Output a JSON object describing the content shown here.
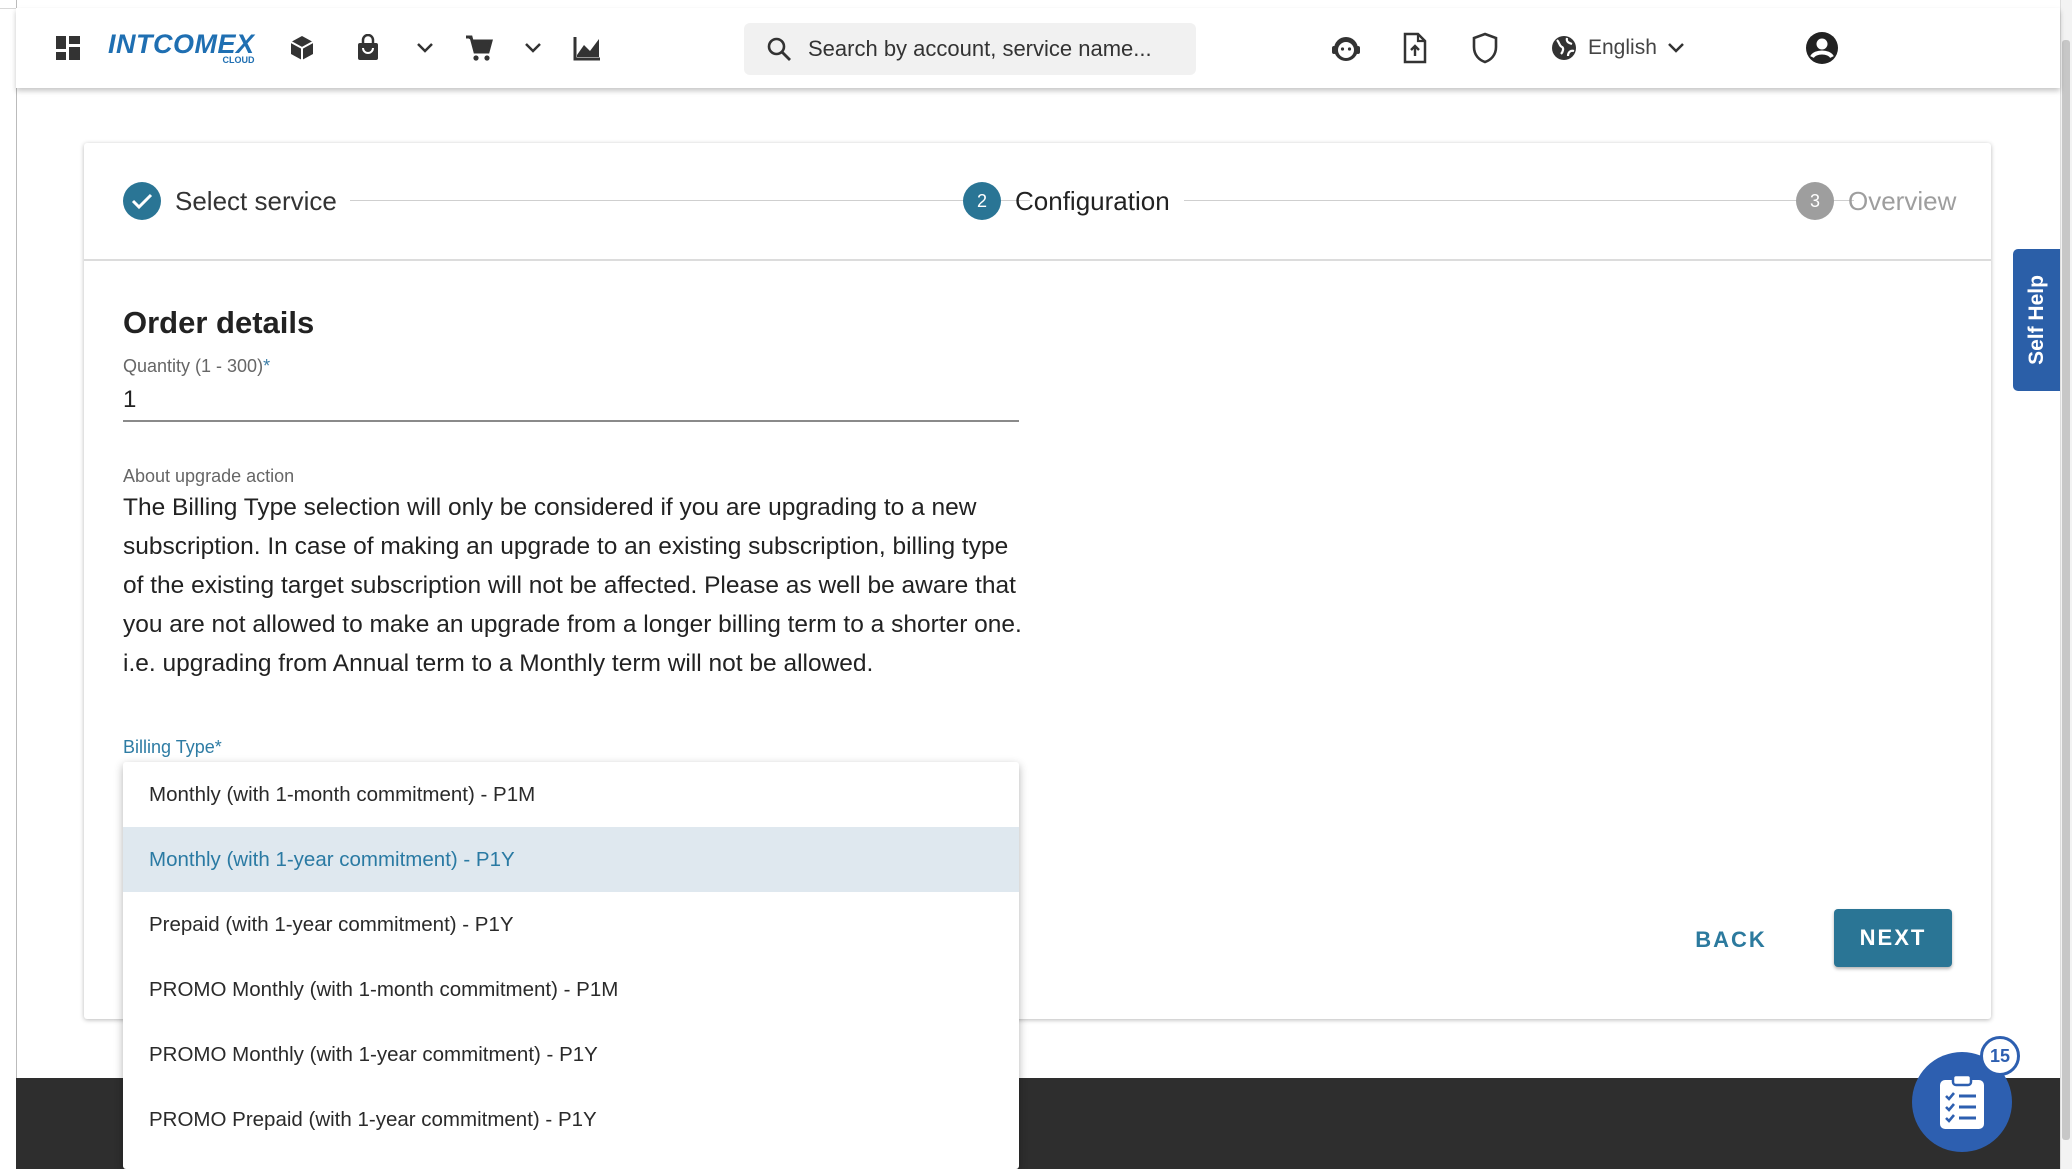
{
  "header": {
    "logo_text": "INTCOMEX",
    "logo_sub": "CLOUD",
    "search_placeholder": "Search by account, service name...",
    "language": "English",
    "icons": [
      "apps-grid-icon",
      "box-icon",
      "bag-icon",
      "chevron-down-icon",
      "cart-icon",
      "chevron-down-icon",
      "chart-icon",
      "search-icon",
      "support-agent-icon",
      "file-upload-icon",
      "shield-icon",
      "globe-icon",
      "account-circle-icon"
    ]
  },
  "stepper": {
    "steps": [
      {
        "number": "1",
        "label": "Select service",
        "state": "completed"
      },
      {
        "number": "2",
        "label": "Configuration",
        "state": "active"
      },
      {
        "number": "3",
        "label": "Overview",
        "state": "pending"
      }
    ]
  },
  "form": {
    "section_title": "Order details",
    "quantity_label": "Quantity (1 - 300)",
    "required_mark": "*",
    "quantity_value": "1",
    "about_label": "About upgrade action",
    "about_text": "The Billing Type selection will only be considered if you are upgrading to a new subscription. In case of making an upgrade to an existing subscription, billing type of the existing target subscription will not be affected. Please as well be aware that you are not allowed to make an upgrade from a longer billing term to a shorter one. i.e. upgrading from Annual term to a Monthly term will not be allowed.",
    "billing_label": "Billing Type*"
  },
  "billing_options": [
    "Monthly (with 1-month commitment) - P1M",
    "Monthly (with 1-year commitment) - P1Y",
    "Prepaid (with 1-year commitment) - P1Y",
    "PROMO Monthly (with 1-month commitment) - P1M",
    "PROMO Monthly (with 1-year commitment) - P1Y",
    "PROMO Prepaid (with 1-year commitment) - P1Y"
  ],
  "selected_option_index": 1,
  "buttons": {
    "back": "BACK",
    "next": "NEXT"
  },
  "self_help": "Self Help",
  "tasks_badge": "15",
  "colors": {
    "primary": "#2a7595",
    "brand_blue": "#1f6fb2",
    "self_help_bg": "#2b5fa8",
    "selected_option_bg": "#dfe8ef",
    "footer": "#2e2e2e"
  }
}
